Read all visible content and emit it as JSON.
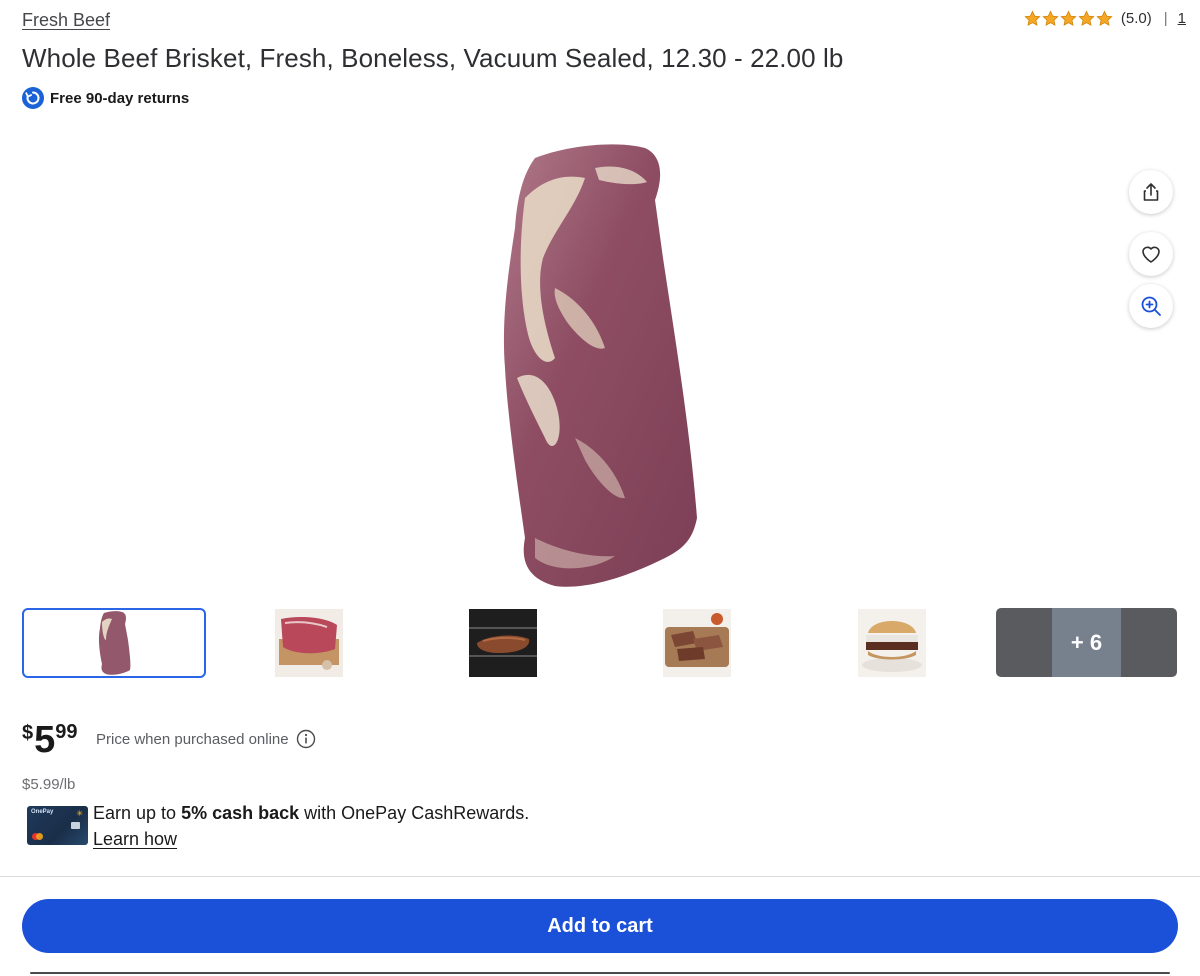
{
  "breadcrumb": "Fresh Beef",
  "rating": {
    "stars": 5,
    "value_text": "(5.0)",
    "separator": "|",
    "count": "1",
    "star_color": "#f5a623"
  },
  "product": {
    "title": "Whole Beef Brisket, Fresh, Boneless, Vacuum Sealed, 12.30 - 22.00 lb",
    "returns_label": "Free 90-day returns"
  },
  "gallery": {
    "more_label": "+ 6",
    "thumbnails": [
      {
        "name": "brisket-front",
        "selected": true
      },
      {
        "name": "brisket-board",
        "selected": false
      },
      {
        "name": "brisket-grill",
        "selected": false
      },
      {
        "name": "brisket-sliced",
        "selected": false
      },
      {
        "name": "brisket-sandwich",
        "selected": false
      }
    ]
  },
  "side_actions": {
    "share_icon": "share-icon",
    "favorite_icon": "heart-icon",
    "zoom_icon": "zoom-in-icon"
  },
  "price": {
    "currency": "$",
    "dollars": "5",
    "cents": "99",
    "note": "Price when purchased online",
    "unit_price": "$5.99/lb"
  },
  "cashback": {
    "prefix": "Earn up to ",
    "highlight": "5% cash back",
    "suffix": " with OnePay CashRewards.",
    "learn_label": "Learn how",
    "card_brand": "OnePay"
  },
  "cart": {
    "button_label": "Add to cart",
    "accent_color": "#1b50d9"
  }
}
